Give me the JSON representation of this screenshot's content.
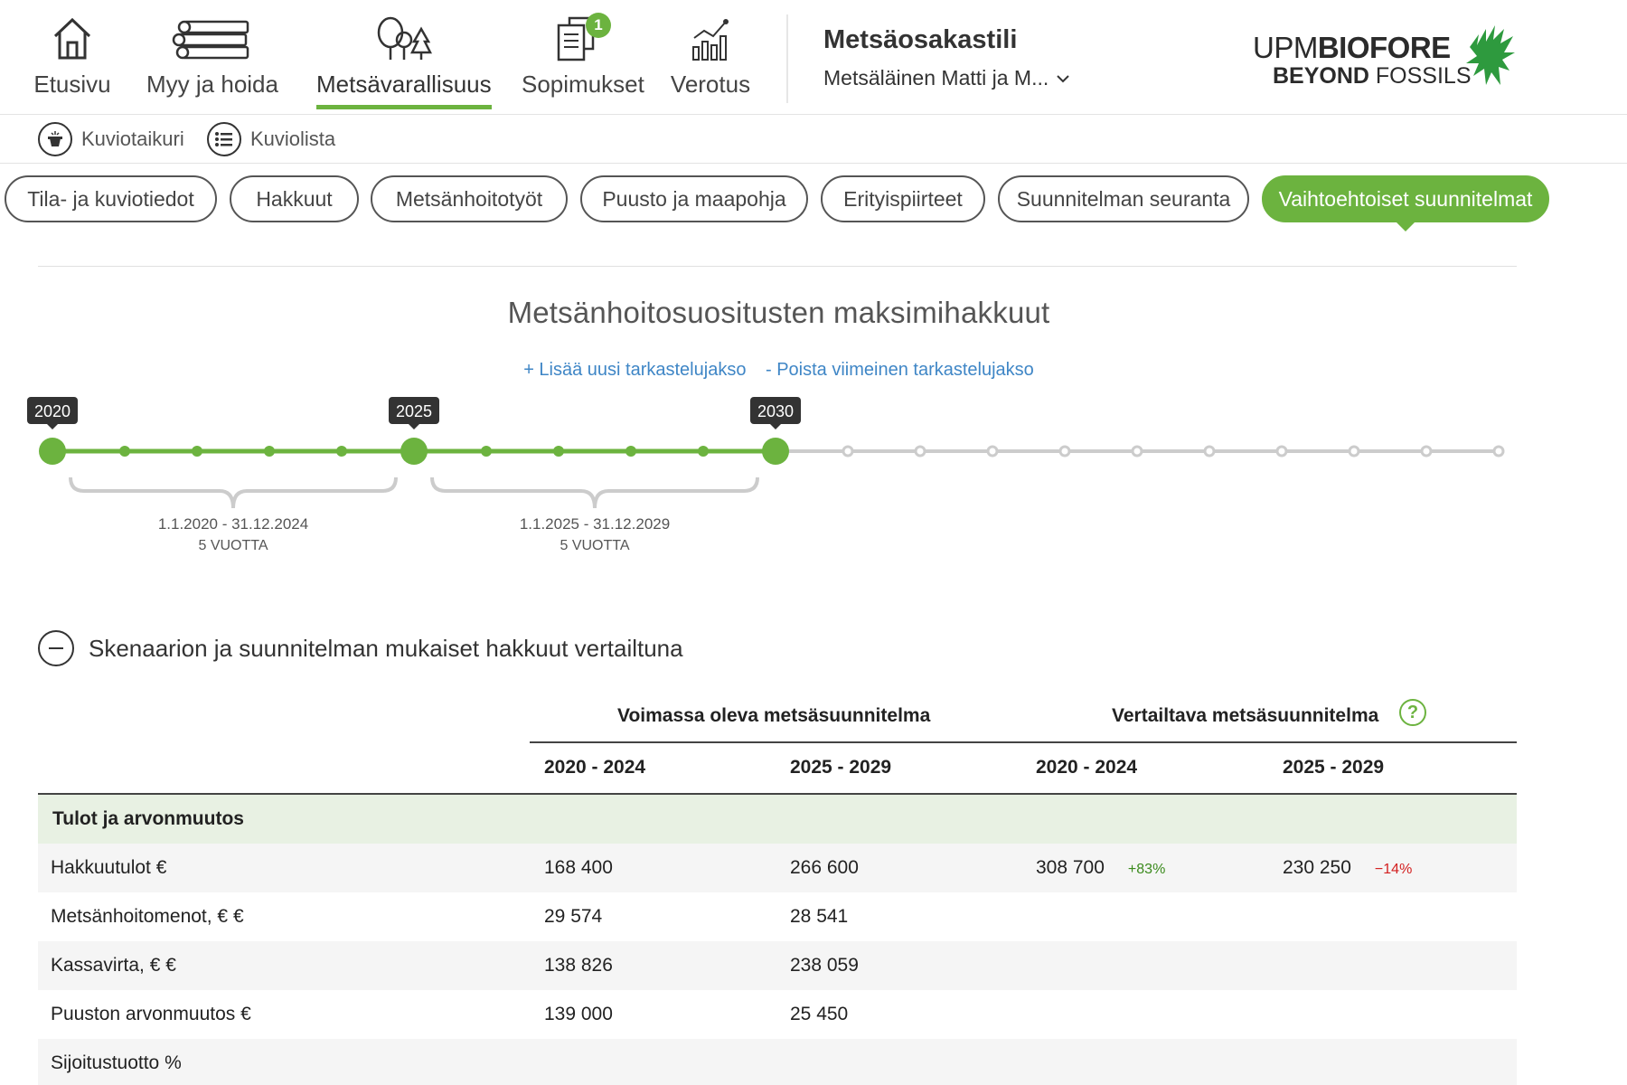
{
  "nav": {
    "items": [
      {
        "label": "Etusivu",
        "icon": "home-icon"
      },
      {
        "label": "Myy ja hoida",
        "icon": "logs-icon"
      },
      {
        "label": "Metsävarallisuus",
        "icon": "trees-icon",
        "active": true
      },
      {
        "label": "Sopimukset",
        "icon": "documents-icon",
        "badge": "1"
      },
      {
        "label": "Verotus",
        "icon": "chart-icon"
      }
    ]
  },
  "account": {
    "title": "Metsäosakastili",
    "subtitle": "Metsäläinen Matti ja M..."
  },
  "logo": {
    "line1_prefix": "UPM",
    "line1_bold": "BIOFORE",
    "line2_bold": "BEYOND",
    "line2_rest": " FOSSILS",
    "brand_color": "#2e9a3e"
  },
  "tools": [
    {
      "label": "Kuviotaikuri",
      "icon": "magic-hat-icon"
    },
    {
      "label": "Kuviolista",
      "icon": "list-icon"
    }
  ],
  "tabs": [
    {
      "label": "Tila- ja kuviotiedot"
    },
    {
      "label": "Hakkuut"
    },
    {
      "label": "Metsänhoitotyöt"
    },
    {
      "label": "Puusto ja maapohja"
    },
    {
      "label": "Erityispiirteet"
    },
    {
      "label": "Suunnitelman seuranta"
    },
    {
      "label": "Vaihtoehtoiset suunnitelmat",
      "active": true
    }
  ],
  "timeline": {
    "title": "Metsänhoitosuositusten maksimihakkuut",
    "add_link": "+ Lisää uusi tarkastelujakso",
    "remove_link": "- Poista viimeinen tarkastelujakso",
    "markers": [
      "2020",
      "2025",
      "2030"
    ],
    "periods": [
      {
        "range": "1.1.2020 - 31.12.2024",
        "length": "5 VUOTTA"
      },
      {
        "range": "1.1.2025 - 31.12.2029",
        "length": "5 VUOTTA"
      }
    ],
    "accent": "#6cb33f",
    "inactive": "#cccccc"
  },
  "comparison": {
    "title": "Skenaarion ja suunnitelman mukaiset hakkuut vertailtuna",
    "plan_current": "Voimassa oleva metsäsuunnitelma",
    "plan_compare": "Vertailtava metsäsuunnitelma",
    "help": "?",
    "years": [
      "2020 - 2024",
      "2025 - 2029",
      "2020 - 2024",
      "2025 - 2029"
    ],
    "section": "Tulot ja arvonmuutos",
    "rows": [
      {
        "label": "Hakkuutulot €",
        "c1": "168 400",
        "c2": "266 600",
        "c3": "308 700",
        "d3": "+83%",
        "c4": "230 250",
        "d4": "−14%"
      },
      {
        "label": "Metsänhoitomenot, € €",
        "c1": "29 574",
        "c2": "28 541",
        "c3": "",
        "d3": "",
        "c4": "",
        "d4": ""
      },
      {
        "label": "Kassavirta, € €",
        "c1": "138 826",
        "c2": "238 059",
        "c3": "",
        "d3": "",
        "c4": "",
        "d4": ""
      },
      {
        "label": "Puuston arvonmuutos €",
        "c1": "139 000",
        "c2": "25 450",
        "c3": "",
        "d3": "",
        "c4": "",
        "d4": ""
      },
      {
        "label": "Sijoitustuotto %",
        "c1": "",
        "c2": "",
        "c3": "",
        "d3": "",
        "c4": "",
        "d4": ""
      }
    ]
  }
}
